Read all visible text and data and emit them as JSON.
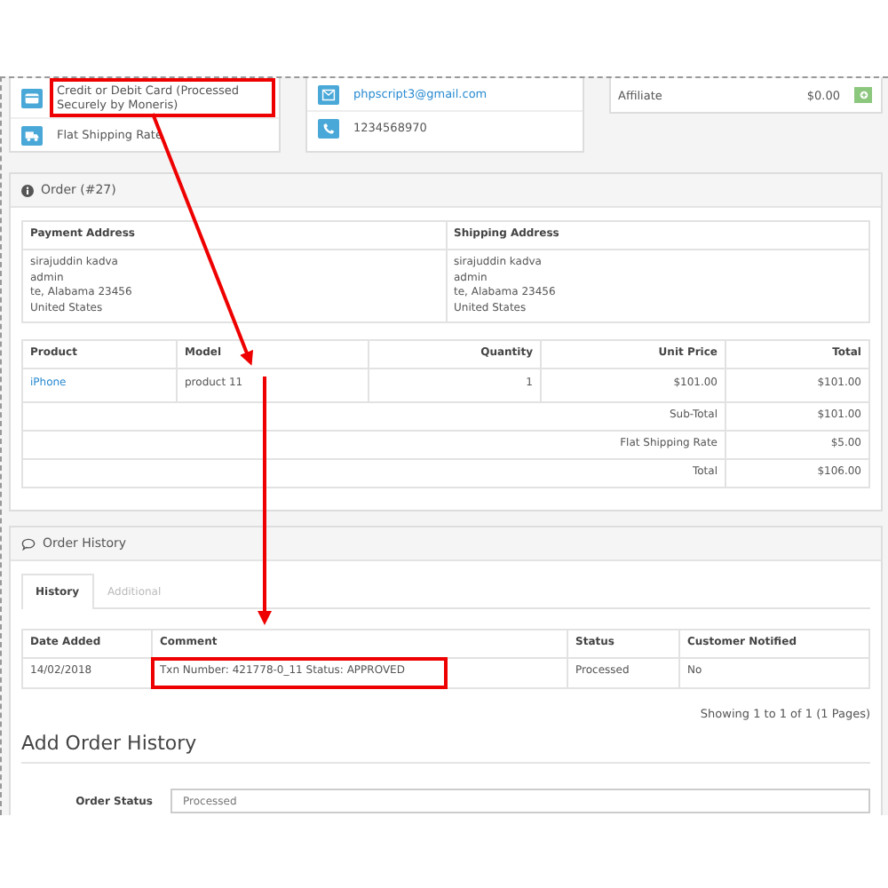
{
  "payment_card": {
    "rows": [
      {
        "kind": "card",
        "text": "Credit or Debit Card (Processed Securely by Moneris)"
      },
      {
        "kind": "truck",
        "text": "Flat Shipping Rate"
      }
    ]
  },
  "customer_card": {
    "rows": [
      {
        "kind": "email",
        "text": "phpscript3@gmail.com"
      },
      {
        "kind": "phone",
        "text": "1234568970"
      }
    ]
  },
  "affiliate_card": {
    "label": "Affiliate",
    "amount": "$0.00"
  },
  "order_panel": {
    "title": "Order (#27)",
    "address_table": {
      "columns": [
        "Payment Address",
        "Shipping Address"
      ],
      "cells": [
        [
          "sirajuddin kadva",
          "admin",
          "te, Alabama 23456",
          "United States"
        ],
        [
          "sirajuddin kadva",
          "admin",
          "te, Alabama 23456",
          "United States"
        ]
      ]
    },
    "product_table": {
      "columns": [
        "Product",
        "Model",
        "Quantity",
        "Unit Price",
        "Total"
      ],
      "rows": [
        [
          "iPhone",
          "product 11",
          "1",
          "$101.00",
          "$101.00"
        ]
      ],
      "totals": [
        {
          "label": "Sub-Total",
          "value": "$101.00"
        },
        {
          "label": "Flat Shipping Rate",
          "value": "$5.00"
        },
        {
          "label": "Total",
          "value": "$106.00"
        }
      ]
    }
  },
  "history_panel": {
    "title": "Order History",
    "tabs": [
      {
        "label": "History",
        "selected": true
      },
      {
        "label": "Additional",
        "selected": false
      }
    ],
    "table": {
      "columns": [
        "Date Added",
        "Comment",
        "Status",
        "Customer Notified"
      ],
      "rows": [
        [
          "14/02/2018",
          "Txn Number: 421778-0_11 Status: APPROVED",
          "Processed",
          "No"
        ]
      ]
    },
    "pagination": "Showing 1 to 1 of 1 (1 Pages)"
  },
  "add_history": {
    "title": "Add Order History",
    "field_label": "Order Status",
    "field_value": "Processed"
  }
}
